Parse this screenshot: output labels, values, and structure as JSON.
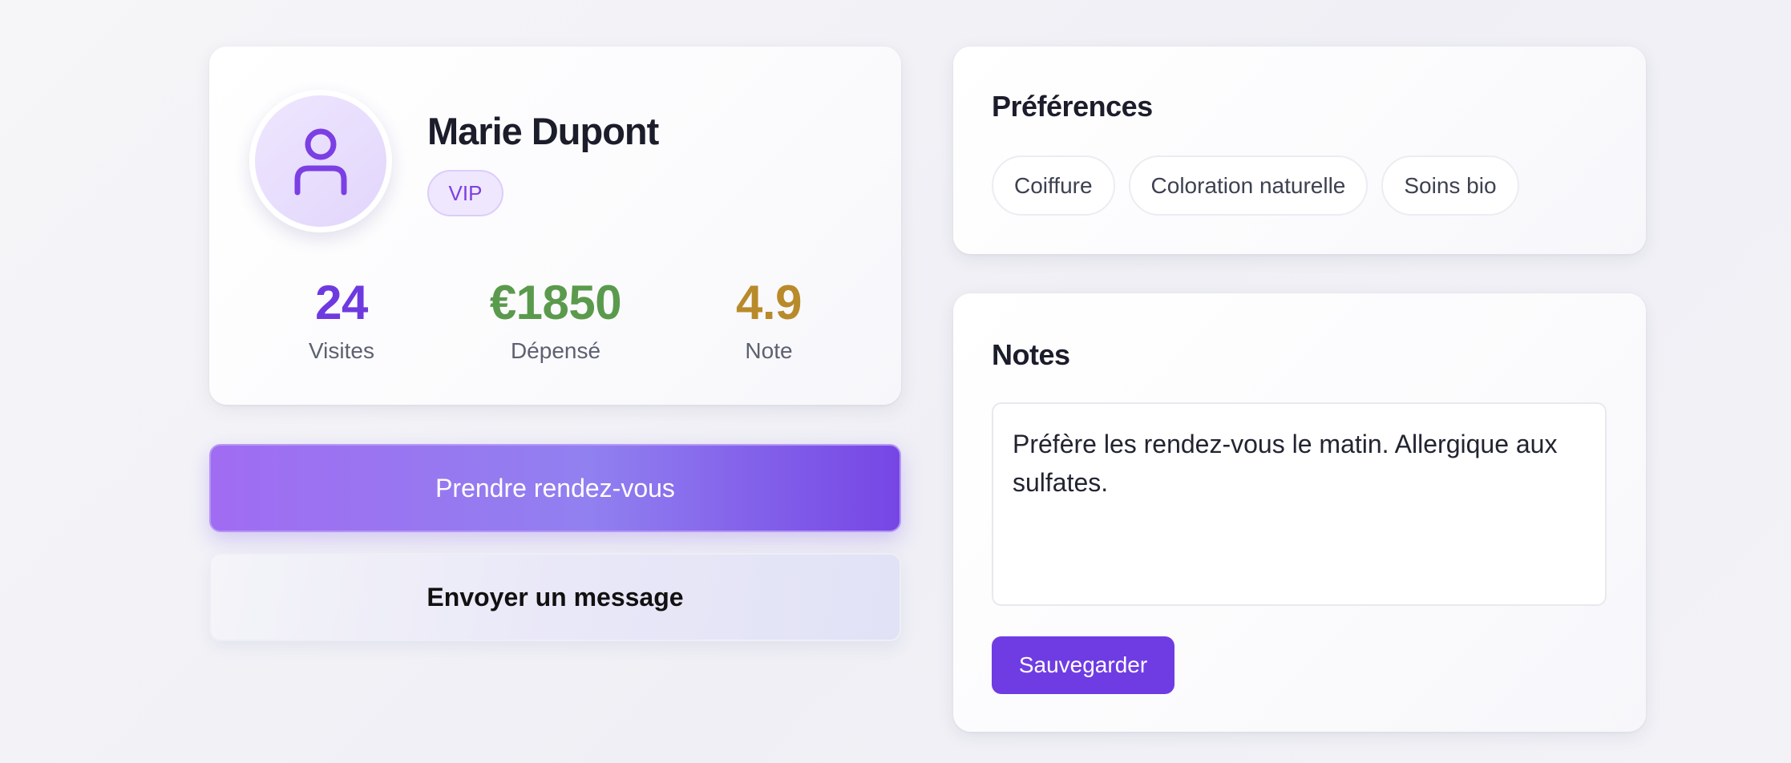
{
  "profile": {
    "name": "Marie Dupont",
    "badge": "VIP",
    "avatar_icon": "user-icon",
    "stats": [
      {
        "value": "24",
        "label": "Visites",
        "color": "#6e3ae0"
      },
      {
        "value": "€1850",
        "label": "Dépensé",
        "color": "#5a9a4c"
      },
      {
        "value": "4.9",
        "label": "Note",
        "color": "#b98a2a"
      }
    ]
  },
  "actions": {
    "book_label": "Prendre rendez-vous",
    "message_label": "Envoyer un message"
  },
  "preferences": {
    "title": "Préférences",
    "tags": [
      "Coiffure",
      "Coloration naturelle",
      "Soins bio"
    ]
  },
  "notes": {
    "title": "Notes",
    "text": "Préfère les rendez-vous le matin. Allergique aux sulfates.",
    "save_label": "Sauvegarder"
  },
  "colors": {
    "accent": "#6f3ce3",
    "badge_text": "#7d3fe0"
  }
}
